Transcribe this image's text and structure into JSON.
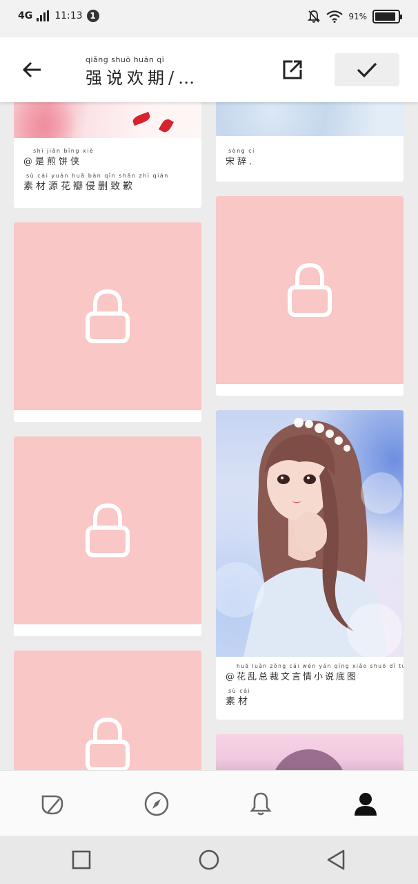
{
  "status_bar": {
    "network": "4G",
    "time": "11:13",
    "notification_count": "1",
    "battery": "91%",
    "battery_level": 0.91
  },
  "app_bar": {
    "title_pinyin": "qiǎng shuō huān  qī",
    "title": "强说欢期/…"
  },
  "cards": {
    "top_left": {
      "line1_pinyin": "shì  jiān  bǐng  xiè",
      "line1": "@是煎饼侠",
      "line2_pinyin": "sù   cái  yuán  huā  bàn   qǐn  shān  zhì  qiàn",
      "line2": "素材源花瓣侵删致歉"
    },
    "top_right": {
      "pinyin": "sòng  cí",
      "text": "宋辞."
    },
    "girl_card": {
      "line1_pinyin": "huā  luàn  zǒng  cái  wén  yán  qíng  xiǎo  shuō  dǐ   tú",
      "line1": "@花乱总裁文言情小说底图",
      "line2_pinyin": "sù  cái",
      "line2": "素材"
    }
  },
  "icons": {
    "back": "arrow-left-icon",
    "share": "external-link-icon",
    "confirm": "check-icon",
    "lock": "lock-icon",
    "nav_home": "leaf-icon",
    "nav_discover": "compass-icon",
    "nav_notifications": "bell-icon",
    "nav_profile": "person-icon"
  },
  "colors": {
    "locked_bg": "#f8c7c6",
    "background": "#ececec"
  }
}
